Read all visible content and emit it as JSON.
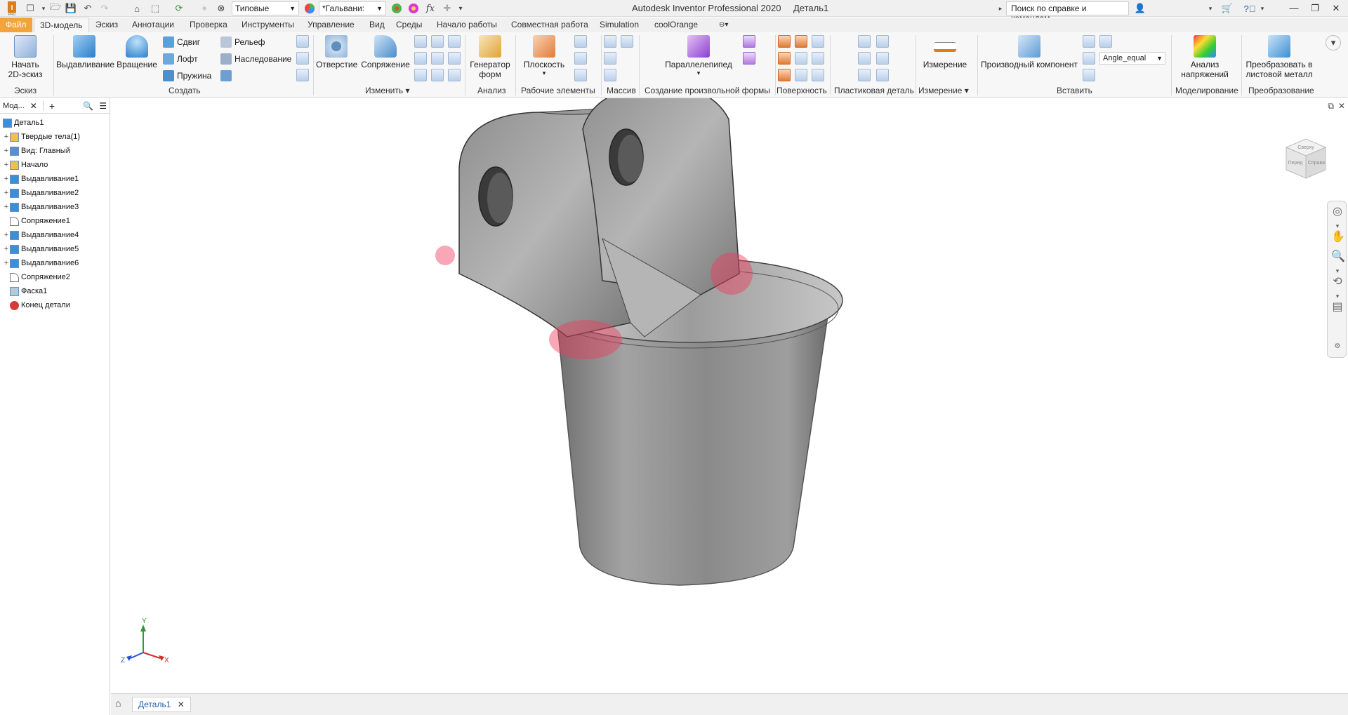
{
  "window": {
    "app_title": "Autodesk Inventor Professional 2020",
    "document_title": "Деталь1"
  },
  "quick_access": {
    "appearance_combo": "Типовые",
    "material_combo": "*Гальвани:",
    "help_search_placeholder": "Поиск по справке и командам..."
  },
  "tabs": [
    {
      "label": "Файл"
    },
    {
      "label": "3D-модель"
    },
    {
      "label": "Эскиз"
    },
    {
      "label": "Аннотации"
    },
    {
      "label": "Проверка"
    },
    {
      "label": "Инструменты"
    },
    {
      "label": "Управление"
    },
    {
      "label": "Вид"
    },
    {
      "label": "Среды"
    },
    {
      "label": "Начало работы"
    },
    {
      "label": "Совместная работа"
    },
    {
      "label": "Simulation"
    },
    {
      "label": "coolOrange"
    }
  ],
  "ribbon": {
    "sketch": {
      "start_label": "Начать",
      "start_label2": "2D-эскиз",
      "title": "Эскиз"
    },
    "create": {
      "extrude": "Выдавливание",
      "revolve": "Вращение",
      "sweep": "Сдвиг",
      "loft": "Лофт",
      "coil": "Пружина",
      "emboss": "Рельеф",
      "derive": "Наследование",
      "title": "Создать"
    },
    "modify": {
      "hole": "Отверстие",
      "fillet": "Сопряжение",
      "title": "Изменить"
    },
    "explore": {
      "shape_gen": "Генератор",
      "shape_gen2": "форм",
      "title": "Анализ"
    },
    "work_features": {
      "plane": "Плоскость",
      "title": "Рабочие элементы"
    },
    "pattern": {
      "title": "Массив"
    },
    "freeform": {
      "box": "Параллелепипед",
      "title": "Создание произвольной формы"
    },
    "surface": {
      "title": "Поверхность"
    },
    "plastic": {
      "title": "Пластиковая деталь"
    },
    "measure": {
      "measure": "Измерение",
      "title": "Измерение"
    },
    "insert": {
      "derived": "Производный компонент",
      "param_combo": "Angle_equal",
      "title": "Вставить"
    },
    "simulation": {
      "stress": "Анализ",
      "stress2": "напряжений",
      "title": "Моделирование"
    },
    "convert": {
      "sheet": "Преобразовать в",
      "sheet2": "листовой металл",
      "title": "Преобразование"
    }
  },
  "browser": {
    "header_label": "Мод...",
    "items": [
      {
        "label": "Деталь1",
        "type": "part",
        "expandable": false,
        "indent": 0
      },
      {
        "label": "Твердые тела(1)",
        "type": "folder",
        "expandable": true,
        "indent": 1
      },
      {
        "label": "Вид: Главный",
        "type": "view",
        "expandable": true,
        "indent": 1
      },
      {
        "label": "Начало",
        "type": "folder",
        "expandable": true,
        "indent": 1
      },
      {
        "label": "Выдавливание1",
        "type": "extrude",
        "expandable": true,
        "indent": 1
      },
      {
        "label": "Выдавливание2",
        "type": "extrude",
        "expandable": true,
        "indent": 1
      },
      {
        "label": "Выдавливание3",
        "type": "extrude",
        "expandable": true,
        "indent": 1
      },
      {
        "label": "Сопряжение1",
        "type": "fillet",
        "expandable": false,
        "indent": 1
      },
      {
        "label": "Выдавливание4",
        "type": "extrude",
        "expandable": true,
        "indent": 1
      },
      {
        "label": "Выдавливание5",
        "type": "extrude",
        "expandable": true,
        "indent": 1
      },
      {
        "label": "Выдавливание6",
        "type": "extrude",
        "expandable": true,
        "indent": 1
      },
      {
        "label": "Сопряжение2",
        "type": "fillet",
        "expandable": false,
        "indent": 1
      },
      {
        "label": "Фаска1",
        "type": "chamfer",
        "expandable": false,
        "indent": 1
      },
      {
        "label": "Конец детали",
        "type": "end",
        "expandable": false,
        "indent": 1
      }
    ]
  },
  "viewcube": {
    "front": "Перед",
    "right": "Справа",
    "top": "Сверху"
  },
  "triad": {
    "x": "X",
    "y": "Y",
    "z": "Z"
  },
  "doc_tabs": [
    {
      "label": "Деталь1"
    }
  ],
  "colors": {
    "file_tab": "#f2a33a",
    "highlight": "#ee3c5a",
    "model_metal": "#8f8f8f"
  }
}
